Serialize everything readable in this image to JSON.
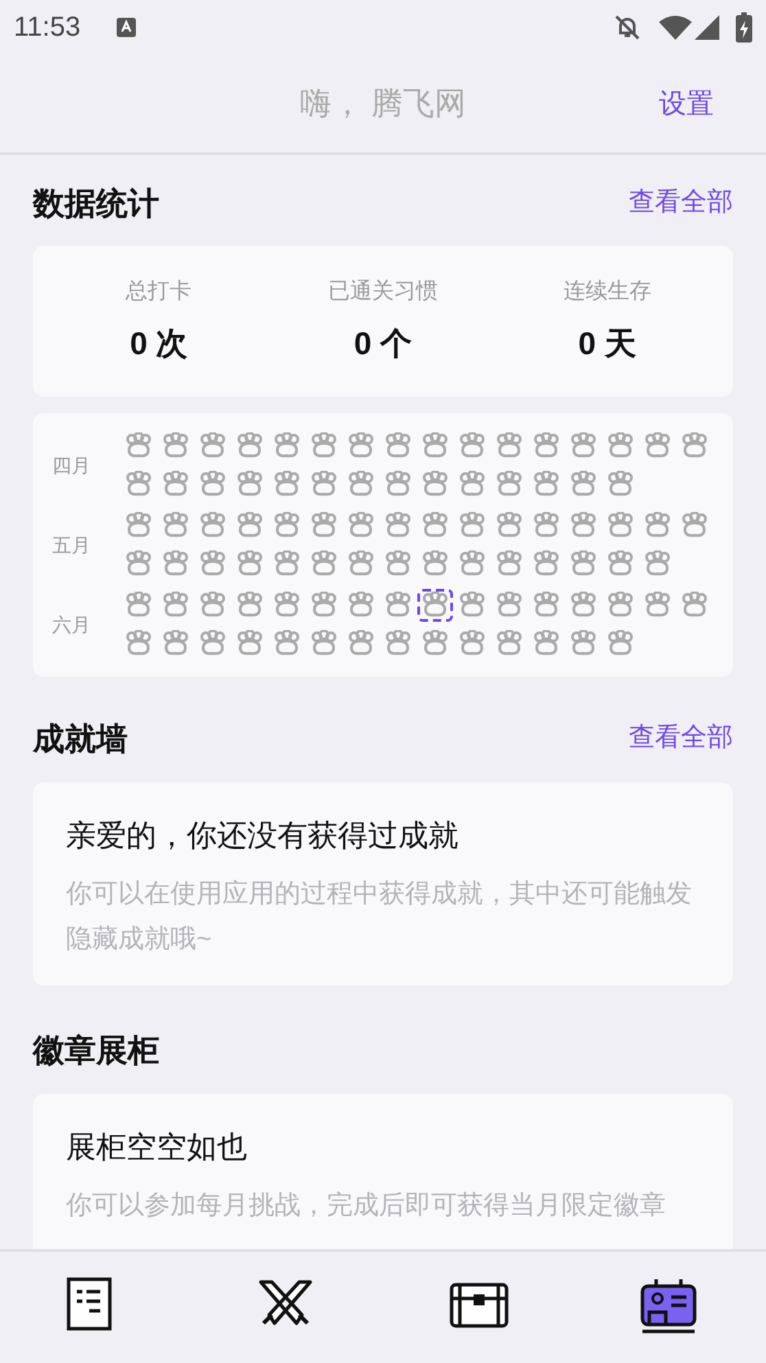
{
  "status_bar": {
    "time": "11:53"
  },
  "header": {
    "title": "嗨， 腾飞网",
    "action": "设置"
  },
  "stats": {
    "title": "数据统计",
    "link": "查看全部",
    "items": [
      {
        "label": "总打卡",
        "value": "0 次"
      },
      {
        "label": "已通关习惯",
        "value": "0 个"
      },
      {
        "label": "连续生存",
        "value": "0 天"
      }
    ]
  },
  "calendar": {
    "months": [
      {
        "label": "四月",
        "days": [
          {
            "selected": false
          },
          {
            "selected": false
          },
          {
            "selected": false
          },
          {
            "selected": false
          },
          {
            "selected": false
          },
          {
            "selected": false
          },
          {
            "selected": false
          },
          {
            "selected": false
          },
          {
            "selected": false
          },
          {
            "selected": false
          },
          {
            "selected": false
          },
          {
            "selected": false
          },
          {
            "selected": false
          },
          {
            "selected": false
          },
          {
            "selected": false
          },
          {
            "selected": false
          },
          {
            "selected": false
          },
          {
            "selected": false
          },
          {
            "selected": false
          },
          {
            "selected": false
          },
          {
            "selected": false
          },
          {
            "selected": false
          },
          {
            "selected": false
          },
          {
            "selected": false
          },
          {
            "selected": false
          },
          {
            "selected": false
          },
          {
            "selected": false
          },
          {
            "selected": false
          },
          {
            "selected": false
          },
          {
            "selected": false
          }
        ]
      },
      {
        "label": "五月",
        "days": [
          {
            "selected": false
          },
          {
            "selected": false
          },
          {
            "selected": false
          },
          {
            "selected": false
          },
          {
            "selected": false
          },
          {
            "selected": false
          },
          {
            "selected": false
          },
          {
            "selected": false
          },
          {
            "selected": false
          },
          {
            "selected": false
          },
          {
            "selected": false
          },
          {
            "selected": false
          },
          {
            "selected": false
          },
          {
            "selected": false
          },
          {
            "selected": false
          },
          {
            "selected": false
          },
          {
            "selected": false
          },
          {
            "selected": false
          },
          {
            "selected": false
          },
          {
            "selected": false
          },
          {
            "selected": false
          },
          {
            "selected": false
          },
          {
            "selected": false
          },
          {
            "selected": false
          },
          {
            "selected": false
          },
          {
            "selected": false
          },
          {
            "selected": false
          },
          {
            "selected": false
          },
          {
            "selected": false
          },
          {
            "selected": false
          },
          {
            "selected": false
          }
        ]
      },
      {
        "label": "六月",
        "days": [
          {
            "selected": false
          },
          {
            "selected": false
          },
          {
            "selected": false
          },
          {
            "selected": false
          },
          {
            "selected": false
          },
          {
            "selected": false
          },
          {
            "selected": false
          },
          {
            "selected": false
          },
          {
            "selected": true
          },
          {
            "selected": false
          },
          {
            "selected": false
          },
          {
            "selected": false
          },
          {
            "selected": false
          },
          {
            "selected": false
          },
          {
            "selected": false
          },
          {
            "selected": false
          },
          {
            "selected": false
          },
          {
            "selected": false
          },
          {
            "selected": false
          },
          {
            "selected": false
          },
          {
            "selected": false
          },
          {
            "selected": false
          },
          {
            "selected": false
          },
          {
            "selected": false
          },
          {
            "selected": false
          },
          {
            "selected": false
          },
          {
            "selected": false
          },
          {
            "selected": false
          },
          {
            "selected": false
          },
          {
            "selected": false
          }
        ]
      }
    ]
  },
  "achievements": {
    "title": "成就墙",
    "link": "查看全部",
    "card": {
      "heading": "亲爱的，你还没有获得过成就",
      "text": "你可以在使用应用的过程中获得成就，其中还可能触发隐藏成就哦~"
    }
  },
  "badges": {
    "title": "徽章展柜",
    "card": {
      "heading": "展柜空空如也",
      "text": "你可以参加每月挑战，完成后即可获得当月限定徽章"
    }
  },
  "nav": [
    {
      "kind": "list",
      "selected": false
    },
    {
      "kind": "swords",
      "selected": false
    },
    {
      "kind": "chest",
      "selected": false
    },
    {
      "kind": "profile",
      "selected": true
    }
  ]
}
